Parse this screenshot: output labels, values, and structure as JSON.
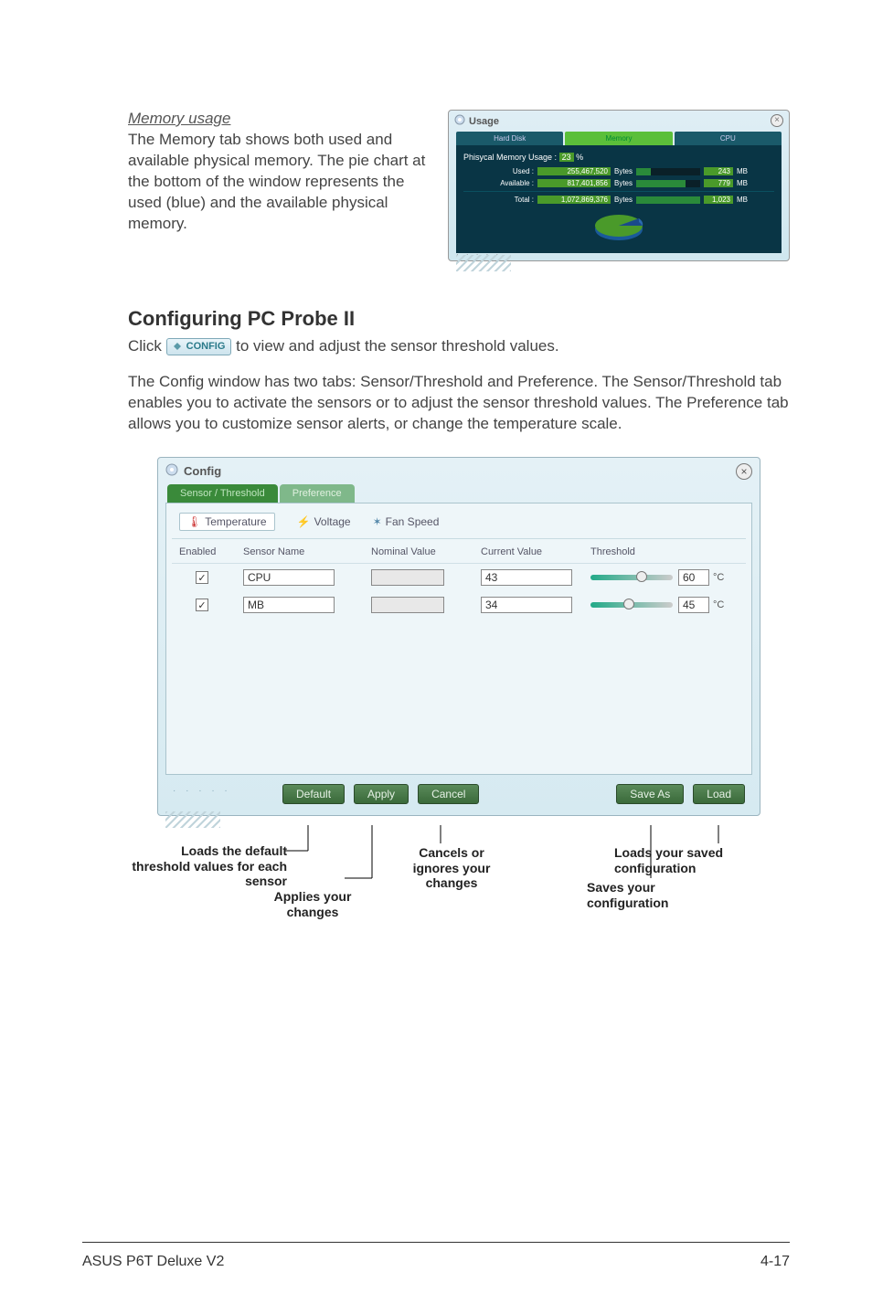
{
  "memory": {
    "heading": "Memory usage",
    "paragraph": "The Memory tab shows both used and available physical memory. The pie chart at the bottom of the window represents the used (blue) and the available physical memory."
  },
  "usageWindow": {
    "title": "Usage",
    "tabs": {
      "hdd": "Hard Disk",
      "memory": "Memory",
      "cpu": "CPU"
    },
    "heading": "Phisycal Memory Usage :",
    "pct": "23",
    "pctUnit": "%",
    "rows": {
      "used": {
        "label": "Used :",
        "bytes": "255,467,520",
        "unit": "Bytes",
        "mb": "243",
        "mbUnit": "MB",
        "barPct": 23
      },
      "avail": {
        "label": "Available :",
        "bytes": "817,401,856",
        "unit": "Bytes",
        "mb": "779",
        "mbUnit": "MB",
        "barPct": 77
      },
      "total": {
        "label": "Total :",
        "bytes": "1,072,869,376",
        "unit": "Bytes",
        "mb": "1,023",
        "mbUnit": "MB",
        "barPct": 100
      }
    }
  },
  "section2": {
    "title": "Configuring PC Probe II",
    "clickPrefix": "Click ",
    "inlineBtn": "CONFIG",
    "clickSuffix": " to view and adjust the sensor threshold values.",
    "para2": "The Config window has two tabs: Sensor/Threshold and Preference. The Sensor/Threshold tab enables you to activate the sensors or to adjust the sensor threshold values. The Preference tab allows you to customize sensor alerts, or change the temperature scale."
  },
  "configWindow": {
    "title": "Config",
    "outerTabs": {
      "sensor": "Sensor / Threshold",
      "pref": "Preference"
    },
    "innerTabs": {
      "temp": "Temperature",
      "volt": "Voltage",
      "fan": "Fan Speed"
    },
    "cols": {
      "enabled": "Enabled",
      "sensorName": "Sensor Name",
      "nominal": "Nominal Value",
      "current": "Current Value",
      "threshold": "Threshold"
    },
    "rows": [
      {
        "name": "CPU",
        "current": "43",
        "threshold": "60",
        "unit": "°C",
        "thumb": 55
      },
      {
        "name": "MB",
        "current": "34",
        "threshold": "45",
        "unit": "°C",
        "thumb": 40
      }
    ],
    "buttons": {
      "default": "Default",
      "apply": "Apply",
      "cancel": "Cancel",
      "saveAs": "Save As",
      "load": "Load"
    }
  },
  "callouts": {
    "loadsDefault": "Loads the default threshold values for each sensor",
    "applies": "Applies your changes",
    "cancels": "Cancels or ignores your changes",
    "loadsSaved": "Loads your saved configuration",
    "saves": "Saves your configuration"
  },
  "footer": {
    "left": "ASUS P6T Deluxe V2",
    "right": "4-17"
  }
}
